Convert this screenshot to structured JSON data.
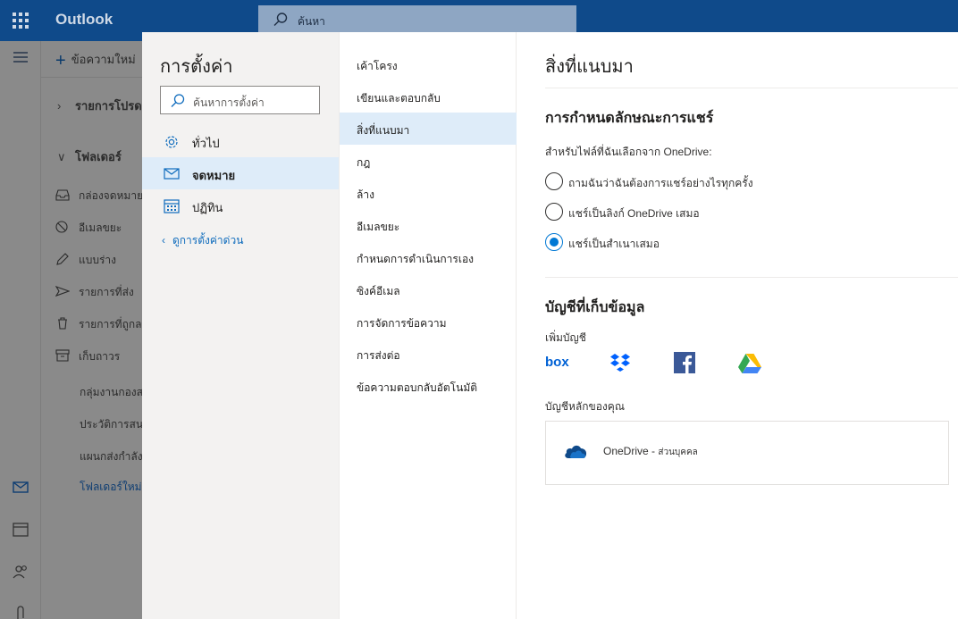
{
  "app": {
    "name": "Outlook"
  },
  "search": {
    "placeholder": "ค้นหา"
  },
  "background": {
    "new_message": "ข้อความใหม่",
    "favorites_header": "รายการโปรด",
    "folders_header": "โฟลเดอร์",
    "folders": [
      {
        "label": "กล่องจดหมาย",
        "icon": "inbox-icon"
      },
      {
        "label": "อีเมลขยะ",
        "icon": "junk-icon"
      },
      {
        "label": "แบบร่าง",
        "icon": "pencil-icon"
      },
      {
        "label": "รายการที่ส่ง",
        "icon": "send-icon"
      },
      {
        "label": "รายการที่ถูกลบ",
        "icon": "trash-icon"
      },
      {
        "label": "เก็บถาวร",
        "icon": "archive-icon"
      }
    ],
    "subfolders": [
      "กลุ่มงานกองส",
      "ประวัติการสน",
      "แผนกส่งกำลัง",
      "โฟลเดอร์ใหม่"
    ]
  },
  "settings": {
    "title": "การตั้งค่า",
    "search_placeholder": "ค้นหาการตั้งค่า",
    "categories": [
      {
        "label": "ทั่วไป",
        "icon": "gear-icon",
        "selected": false
      },
      {
        "label": "จดหมาย",
        "icon": "mail-icon",
        "selected": true
      },
      {
        "label": "ปฏิทิน",
        "icon": "calendar-icon",
        "selected": false
      }
    ],
    "quick_settings_link": "ดูการตั้งค่าด่วน",
    "subcategories": [
      "เค้าโครง",
      "เขียนและตอบกลับ",
      "สิ่งที่แนบมา",
      "กฎ",
      "ล้าง",
      "อีเมลขยะ",
      "กำหนดการดำเนินการเอง",
      "ซิงค์อีเมล",
      "การจัดการข้อความ",
      "การส่งต่อ",
      "ข้อความตอบกลับอัตโนมัติ"
    ],
    "selected_subcategory_index": 2,
    "page": {
      "title": "สิ่งที่แนบมา",
      "share_section_title": "การกำหนดลักษณะการแชร์",
      "share_prompt": "สำหรับไฟล์ที่ฉันเลือกจาก OneDrive:",
      "share_options": [
        {
          "label": "ถามฉันว่าฉันต้องการแชร์อย่างไรทุกครั้ง",
          "checked": false
        },
        {
          "label": "แชร์เป็นลิงก์ OneDrive เสมอ",
          "checked": false
        },
        {
          "label": "แชร์เป็นสำเนาเสมอ",
          "checked": true
        }
      ],
      "storage_section_title": "บัญชีที่เก็บข้อมูล",
      "add_account_label": "เพิ่มบัญชี",
      "services": [
        {
          "name": "box",
          "icon": "box-icon",
          "color": "#0061d5"
        },
        {
          "name": "Dropbox",
          "icon": "dropbox-icon",
          "color": "#0061fe"
        },
        {
          "name": "Facebook",
          "icon": "facebook-icon",
          "color": "#3b5998"
        },
        {
          "name": "Google Drive",
          "icon": "google-drive-icon",
          "color": "#34a853"
        }
      ],
      "primary_accounts_label": "บัญชีหลักของคุณ",
      "primary_account": {
        "name": "OneDrive",
        "type": "ส่วนบุคคล",
        "separator": "-"
      }
    }
  },
  "colors": {
    "topbar": "#0f4a8a",
    "accent": "#0078d4",
    "selection": "#deecf9"
  }
}
